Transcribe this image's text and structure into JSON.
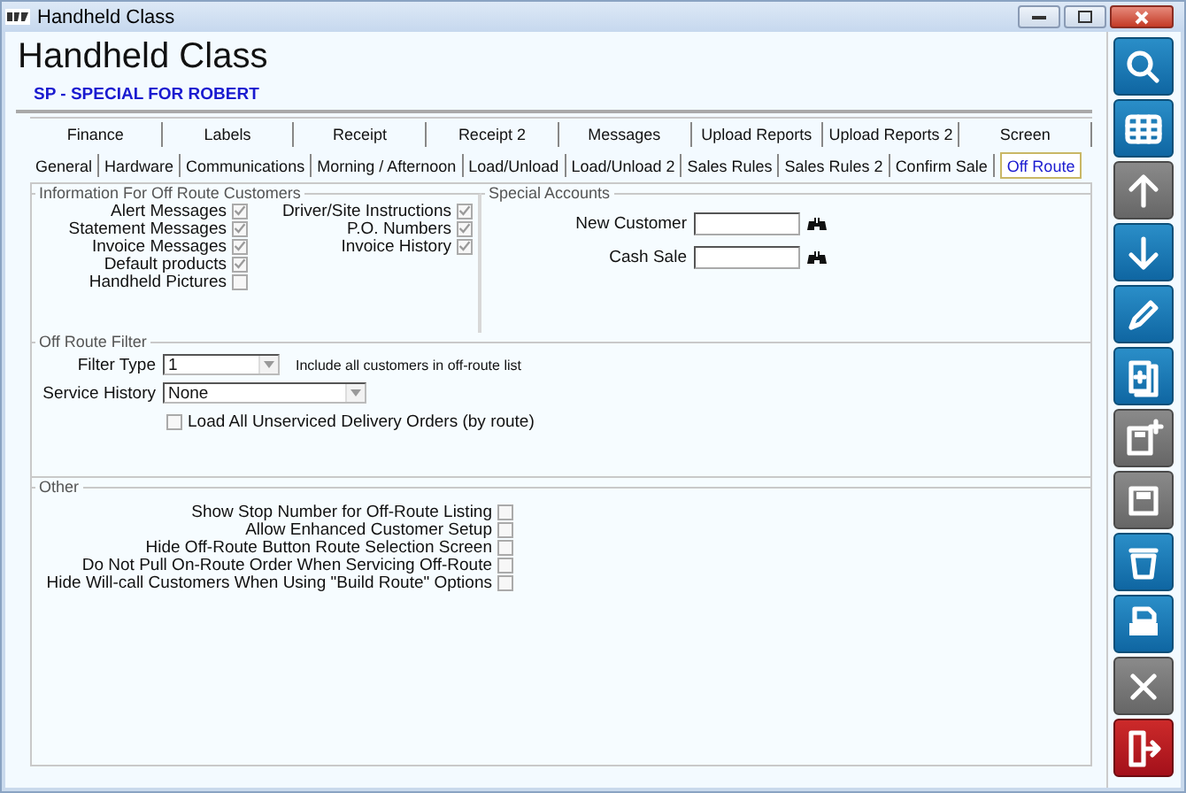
{
  "window": {
    "title": "Handheld Class"
  },
  "heading": "Handheld Class",
  "subtitle": "SP - SPECIAL FOR  ROBERT",
  "tab_rows": [
    [
      {
        "label": "Finance",
        "selected": false
      },
      {
        "label": "Labels",
        "selected": false
      },
      {
        "label": "Receipt",
        "selected": false
      },
      {
        "label": "Receipt 2",
        "selected": false
      },
      {
        "label": "Messages",
        "selected": false
      },
      {
        "label": "Upload Reports",
        "selected": false
      },
      {
        "label": "Upload Reports 2",
        "selected": false
      },
      {
        "label": "Screen",
        "selected": false
      }
    ],
    [
      {
        "label": "General",
        "selected": false
      },
      {
        "label": "Hardware",
        "selected": false
      },
      {
        "label": "Communications",
        "selected": false
      },
      {
        "label": "Morning / Afternoon",
        "selected": false
      },
      {
        "label": "Load/Unload",
        "selected": false
      },
      {
        "label": "Load/Unload 2",
        "selected": false
      },
      {
        "label": "Sales Rules",
        "selected": false
      },
      {
        "label": "Sales Rules 2",
        "selected": false
      },
      {
        "label": "Confirm Sale",
        "selected": false
      },
      {
        "label": "Off Route",
        "selected": true
      }
    ]
  ],
  "info_group": {
    "title": "Information For Off Route Customers",
    "columns": [
      [
        {
          "label": "Alert Messages",
          "checked": true
        },
        {
          "label": "Statement Messages",
          "checked": true
        },
        {
          "label": "Invoice Messages",
          "checked": true
        },
        {
          "label": "Default products",
          "checked": true
        },
        {
          "label": "Handheld Pictures",
          "checked": false
        }
      ],
      [
        {
          "label": "Driver/Site Instructions",
          "checked": true
        },
        {
          "label": "P.O. Numbers",
          "checked": true
        },
        {
          "label": "Invoice History",
          "checked": true
        }
      ]
    ]
  },
  "special_accounts": {
    "title": "Special Accounts",
    "fields": [
      {
        "label": "New Customer"
      },
      {
        "label": "Cash Sale"
      }
    ]
  },
  "filter_group": {
    "title": "Off Route Filter",
    "filter_type": {
      "label": "Filter Type",
      "value": "1",
      "note": "Include all customers in off-route list"
    },
    "service_history": {
      "label": "Service History",
      "value": "None"
    },
    "load_all": {
      "label": "Load All Unserviced Delivery Orders (by route)",
      "checked": false
    }
  },
  "other_group": {
    "title": "Other",
    "options": [
      {
        "label": "Show Stop Number for Off-Route Listing",
        "checked": false
      },
      {
        "label": "Allow Enhanced Customer Setup",
        "checked": false
      },
      {
        "label": "Hide Off-Route Button Route Selection Screen",
        "checked": false
      },
      {
        "label": "Do Not Pull On-Route Order When Servicing Off-Route",
        "checked": false
      },
      {
        "label": "Hide Will-call Customers When Using \"Build Route\" Options",
        "checked": false
      }
    ]
  },
  "toolbar": [
    {
      "kind": "search",
      "disabled": false
    },
    {
      "kind": "grid",
      "disabled": false
    },
    {
      "kind": "up",
      "disabled": true
    },
    {
      "kind": "down",
      "disabled": false
    },
    {
      "kind": "edit",
      "disabled": false
    },
    {
      "kind": "new",
      "disabled": false
    },
    {
      "kind": "save-new",
      "disabled": true
    },
    {
      "kind": "save",
      "disabled": true
    },
    {
      "kind": "delete",
      "disabled": false
    },
    {
      "kind": "print",
      "disabled": false
    },
    {
      "kind": "close",
      "disabled": true
    },
    {
      "kind": "exit",
      "disabled": false
    }
  ]
}
